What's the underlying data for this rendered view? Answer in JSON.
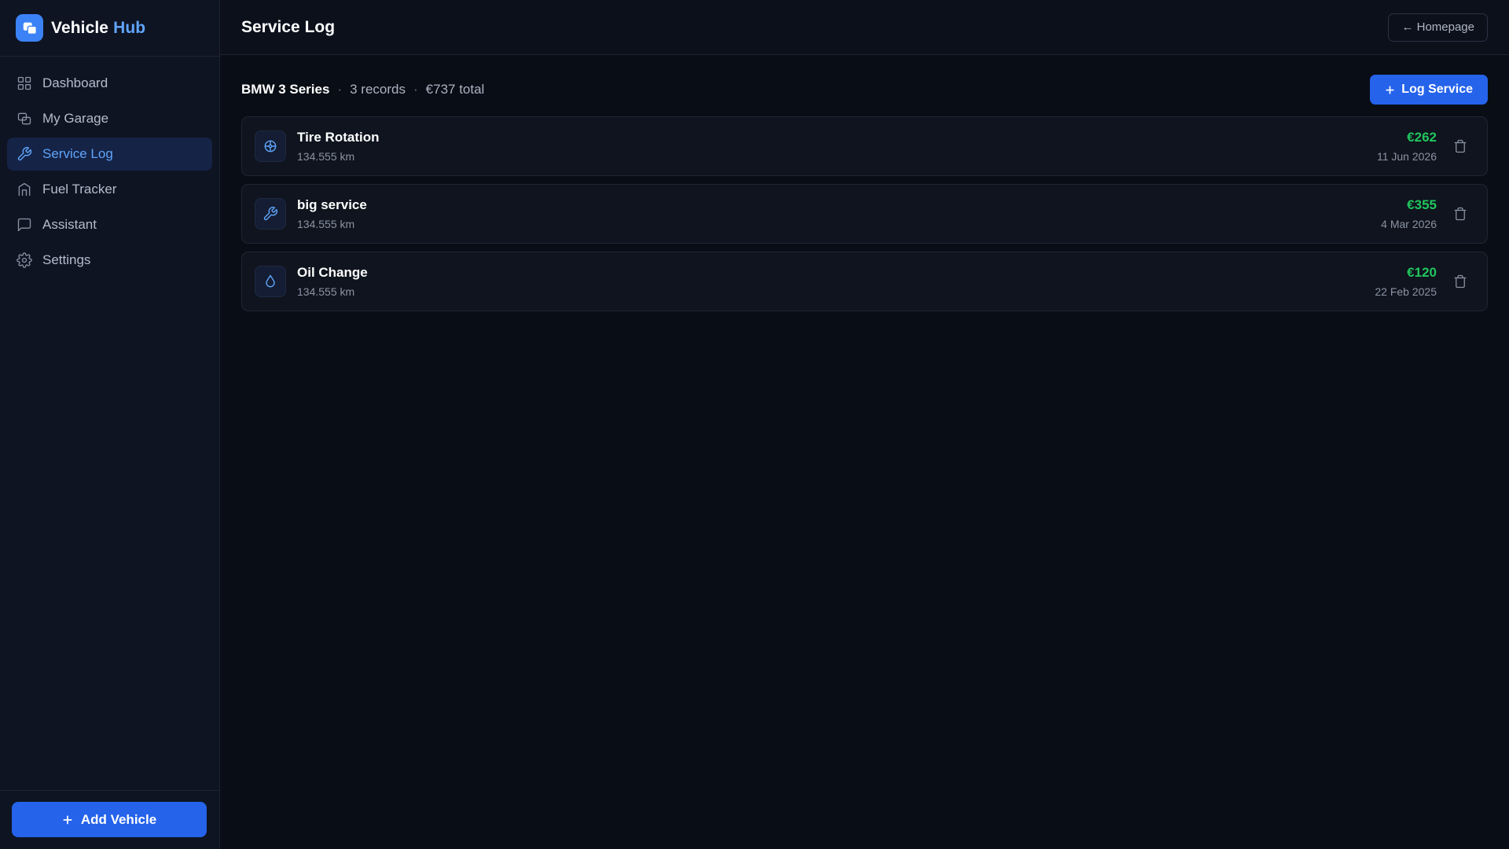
{
  "brand": {
    "name": "Vehicle",
    "accent": "Hub"
  },
  "sidebar": {
    "items": [
      {
        "label": "Dashboard",
        "icon": "grid-icon"
      },
      {
        "label": "My Garage",
        "icon": "cars-icon"
      },
      {
        "label": "Service Log",
        "icon": "wrench-icon",
        "active": true
      },
      {
        "label": "Fuel Tracker",
        "icon": "fuel-icon"
      },
      {
        "label": "Assistant",
        "icon": "chat-icon"
      },
      {
        "label": "Settings",
        "icon": "gear-icon"
      }
    ],
    "add_vehicle_label": "Add Vehicle"
  },
  "header": {
    "title": "Service Log",
    "home_label": "← Homepage"
  },
  "summary": {
    "vehicle": "BMW 3 Series",
    "records": "3 records",
    "total": "€737 total",
    "separator": "·"
  },
  "log_service_label": "Log Service",
  "records": [
    {
      "name": "Tire Rotation",
      "km": "134.555 km",
      "cost": "€262",
      "date": "11 Jun 2026",
      "icon": "tire-icon"
    },
    {
      "name": "big service",
      "km": "134.555 km",
      "cost": "€355",
      "date": "4 Mar 2026",
      "icon": "wrench-icon"
    },
    {
      "name": "Oil Change",
      "km": "134.555 km",
      "cost": "€120",
      "date": "22 Feb 2025",
      "icon": "oil-drop-icon"
    }
  ],
  "colors": {
    "accent": "#2563eb",
    "active_nav_bg": "#152347",
    "active_nav_text": "#60a5fa",
    "cost": "#22c55e",
    "background": "#090d16"
  }
}
